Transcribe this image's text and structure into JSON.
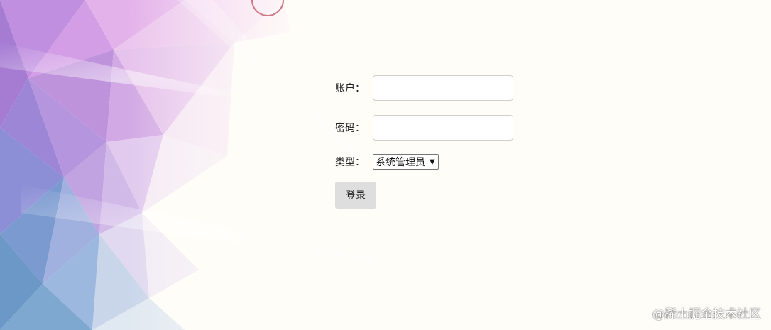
{
  "form": {
    "account_label": "账户：",
    "account_value": "",
    "password_label": "密码：",
    "password_value": "",
    "type_label": "类型：",
    "type_selected": "系统管理员",
    "submit_label": "登录"
  },
  "watermark": {
    "url": "https://blog.csdn.net/...",
    "brand": "@稀土掘金技术社区"
  },
  "colors": {
    "background": "#fffdf8",
    "poly_purple": "#b487d6",
    "poly_pink": "#eab2df",
    "poly_blue": "#6f97c4",
    "button_bg": "#dedede",
    "input_border": "#cfcfcf"
  }
}
